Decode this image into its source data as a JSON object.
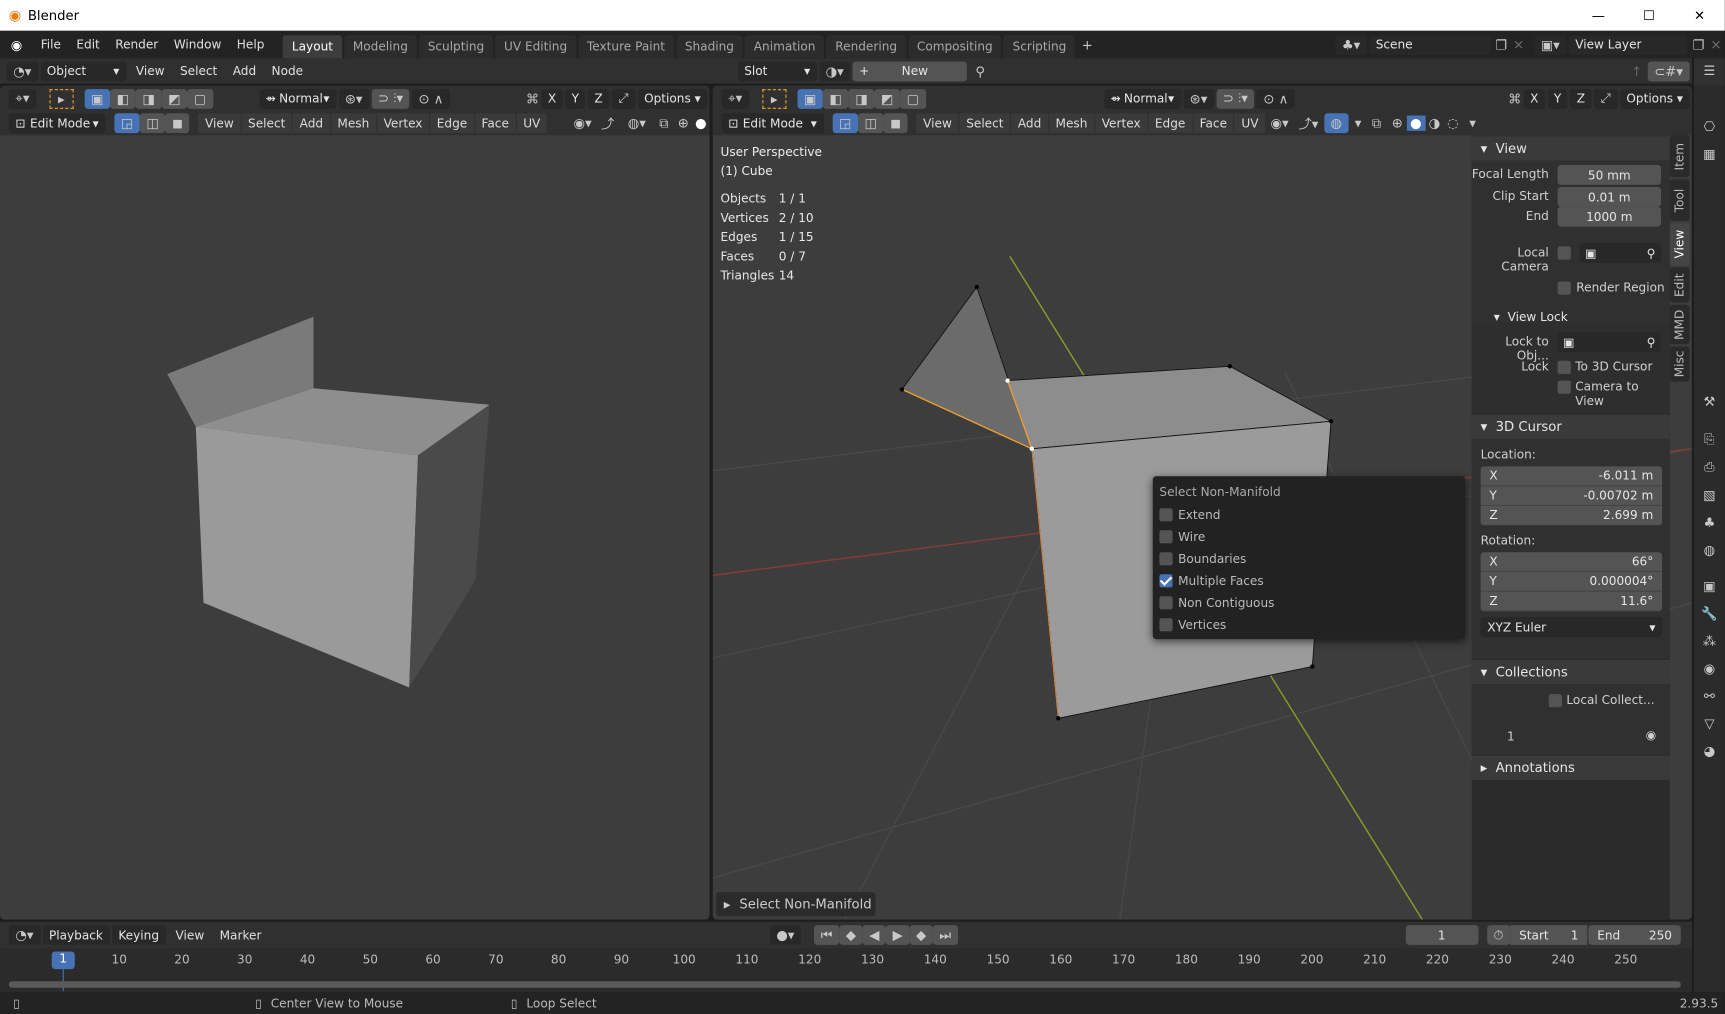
{
  "window": {
    "title": "Blender",
    "controls": [
      "minimize-icon",
      "maximize-icon",
      "close-icon"
    ]
  },
  "menu": [
    "File",
    "Edit",
    "Render",
    "Window",
    "Help"
  ],
  "workspaces": [
    "Layout",
    "Modeling",
    "Sculpting",
    "UV Editing",
    "Texture Paint",
    "Shading",
    "Animation",
    "Rendering",
    "Compositing",
    "Scripting"
  ],
  "active_workspace": "Layout",
  "scene": {
    "name": "Scene",
    "view_layer": "View Layer"
  },
  "shader_header": {
    "object_mode": "Object",
    "menus": [
      "View",
      "Select",
      "Add",
      "Node"
    ],
    "slot": "Slot",
    "new_label": "New"
  },
  "tool_header": {
    "orientation": "Normal",
    "axes": [
      "X",
      "Y",
      "Z"
    ],
    "options": "Options"
  },
  "viewport_header": {
    "mode": "Edit Mode",
    "menus": [
      "View",
      "Select",
      "Add",
      "Mesh",
      "Vertex",
      "Edge",
      "Face",
      "UV"
    ]
  },
  "overlay": {
    "perspective": "User Perspective",
    "object": "(1) Cube",
    "stats": [
      {
        "k": "Objects",
        "v": "1 / 1"
      },
      {
        "k": "Vertices",
        "v": "2 / 10"
      },
      {
        "k": "Edges",
        "v": "1 / 15"
      },
      {
        "k": "Faces",
        "v": "0 / 7"
      },
      {
        "k": "Triangles",
        "v": "14"
      }
    ]
  },
  "popup": {
    "title": "Select Non-Manifold",
    "options": [
      {
        "label": "Extend",
        "checked": false
      },
      {
        "label": "Wire",
        "checked": false
      },
      {
        "label": "Boundaries",
        "checked": false
      },
      {
        "label": "Multiple Faces",
        "checked": true
      },
      {
        "label": "Non Contiguous",
        "checked": false
      },
      {
        "label": "Vertices",
        "checked": false
      }
    ]
  },
  "operator_panel": "Select Non-Manifold",
  "sidebar": {
    "tabs": [
      "Item",
      "Tool",
      "View",
      "Edit",
      "MMD",
      "Misc"
    ],
    "active_tab": "View",
    "view": {
      "title": "View",
      "focal_label": "Focal Length",
      "focal": "50 mm",
      "clip_start_label": "Clip Start",
      "clip_start": "0.01 m",
      "end_label": "End",
      "end": "1000 m",
      "local_camera": "Local Camera",
      "render_region": "Render Region"
    },
    "view_lock": {
      "title": "View Lock",
      "lock_obj": "Lock to Obj...",
      "lock": "Lock",
      "to_cursor": "To 3D Cursor",
      "camera_to_view": "Camera to View"
    },
    "cursor": {
      "title": "3D Cursor",
      "location": "Location:",
      "loc": [
        {
          "axis": "X",
          "v": "-6.011 m"
        },
        {
          "axis": "Y",
          "v": "-0.00702 m"
        },
        {
          "axis": "Z",
          "v": "2.699 m"
        }
      ],
      "rotation": "Rotation:",
      "rot": [
        {
          "axis": "X",
          "v": "66°"
        },
        {
          "axis": "Y",
          "v": "0.000004°"
        },
        {
          "axis": "Z",
          "v": "11.6°"
        }
      ],
      "mode": "XYZ Euler"
    },
    "collections": {
      "title": "Collections",
      "local": "Local Collect...",
      "item": "1"
    },
    "annotations": {
      "title": "Annotations"
    }
  },
  "timeline": {
    "menus": [
      "Playback",
      "Keying",
      "View",
      "Marker"
    ],
    "current": "1",
    "start_label": "Start",
    "start": "1",
    "end_label": "End",
    "end": "250",
    "ticks": [
      "1",
      "10",
      "20",
      "30",
      "40",
      "50",
      "60",
      "70",
      "80",
      "90",
      "100",
      "110",
      "120",
      "130",
      "140",
      "150",
      "160",
      "170",
      "180",
      "190",
      "200",
      "210",
      "220",
      "230",
      "240",
      "250"
    ]
  },
  "status": {
    "mid": "Center View to Mouse",
    "right": "Loop Select",
    "version": "2.93.5"
  },
  "colors": {
    "accent": "#4772b3",
    "selection": "#f0a030",
    "x_axis": "#8a3a3a",
    "y_axis": "#8a9a2a"
  }
}
